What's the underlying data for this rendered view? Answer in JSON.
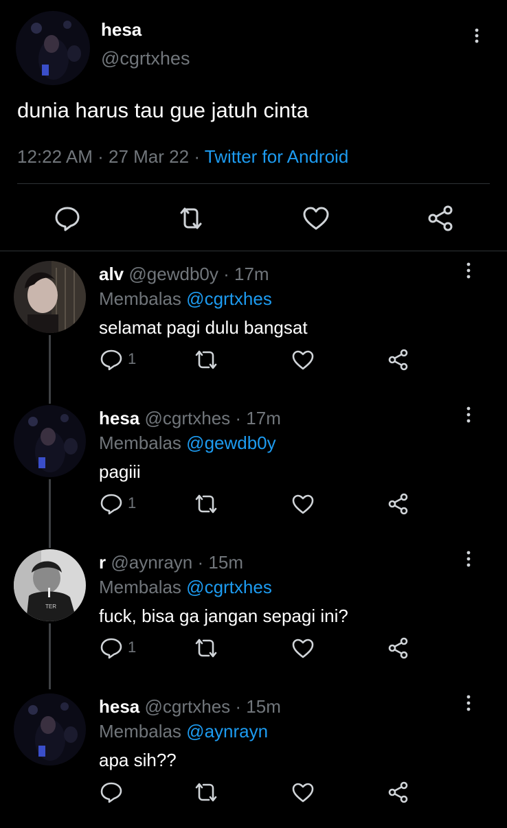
{
  "tweet": {
    "author_name": "hesa",
    "author_handle": "@cgrtxhes",
    "text": "dunia harus tau gue jatuh cinta",
    "time": "12:22 AM",
    "date": "27 Mar 22",
    "source": "Twitter for Android",
    "separator": "·"
  },
  "replies": [
    {
      "name": "alv",
      "handle": "@gewdb0y",
      "age": "17m",
      "replying_label": "Membalas",
      "replying_to": "@cgrtxhes",
      "text": "selamat pagi dulu bangsat",
      "reply_count": "1"
    },
    {
      "name": "hesa",
      "handle": "@cgrtxhes",
      "age": "17m",
      "replying_label": "Membalas",
      "replying_to": "@gewdb0y",
      "text": "pagiii",
      "reply_count": "1"
    },
    {
      "name": "r",
      "handle": "@aynrayn",
      "age": "15m",
      "replying_label": "Membalas",
      "replying_to": "@cgrtxhes",
      "text": "fuck, bisa ga jangan sepagi ini?",
      "reply_count": "1"
    },
    {
      "name": "hesa",
      "handle": "@cgrtxhes",
      "age": "15m",
      "replying_label": "Membalas",
      "replying_to": "@aynrayn",
      "text": "apa sih??",
      "reply_count": ""
    }
  ],
  "icons": {
    "reply": "reply-icon",
    "retweet": "retweet-icon",
    "like": "heart-icon",
    "share": "share-icon",
    "more": "more-vertical-icon"
  },
  "colors": {
    "background": "#000000",
    "accent": "#1d9bf0",
    "secondary_text": "#71767b",
    "icon": "#d0d4d8"
  }
}
